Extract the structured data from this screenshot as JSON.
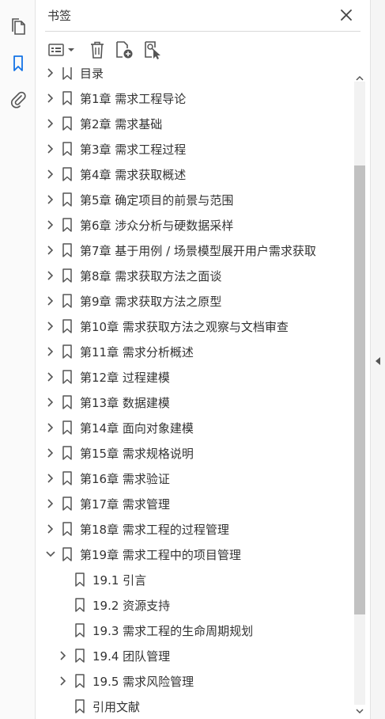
{
  "panel": {
    "title": "书签"
  },
  "rail": {
    "items": [
      {
        "icon": "pages-icon"
      },
      {
        "icon": "bookmark-icon",
        "active": true
      },
      {
        "icon": "attachment-icon"
      }
    ]
  },
  "toolbar": {
    "items": [
      {
        "icon": "options-menu-icon"
      },
      {
        "icon": "delete-icon"
      },
      {
        "icon": "new-bookmark-icon"
      },
      {
        "icon": "bookmark-search-icon"
      }
    ]
  },
  "colors": {
    "accent": "#1473e6",
    "icon": "#555555",
    "scroll_thumb": "#c1c1c1"
  },
  "scroll": {
    "position_fraction": 0.16,
    "visible_fraction": 0.72
  },
  "bookmarks": [
    {
      "label": "目录",
      "level": 0,
      "state": "collapsed"
    },
    {
      "label": "第1章  需求工程导论",
      "level": 0,
      "state": "collapsed"
    },
    {
      "label": "第2章  需求基础",
      "level": 0,
      "state": "collapsed"
    },
    {
      "label": "第3章  需求工程过程",
      "level": 0,
      "state": "collapsed"
    },
    {
      "label": "第4章  需求获取概述",
      "level": 0,
      "state": "collapsed"
    },
    {
      "label": "第5章  确定项目的前景与范围",
      "level": 0,
      "state": "collapsed"
    },
    {
      "label": "第6章  涉众分析与硬数据采样",
      "level": 0,
      "state": "collapsed"
    },
    {
      "label": "第7章  基于用例 / 场景模型展开用户需求获取",
      "level": 0,
      "state": "collapsed"
    },
    {
      "label": "第8章  需求获取方法之面谈",
      "level": 0,
      "state": "collapsed"
    },
    {
      "label": "第9章  需求获取方法之原型",
      "level": 0,
      "state": "collapsed"
    },
    {
      "label": "第10章  需求获取方法之观察与文档审查",
      "level": 0,
      "state": "collapsed"
    },
    {
      "label": "第11章  需求分析概述",
      "level": 0,
      "state": "collapsed"
    },
    {
      "label": "第12章  过程建模",
      "level": 0,
      "state": "collapsed"
    },
    {
      "label": "第13章 数据建模",
      "level": 0,
      "state": "collapsed"
    },
    {
      "label": "第14章 面向对象建模",
      "level": 0,
      "state": "collapsed"
    },
    {
      "label": "第15章  需求规格说明",
      "level": 0,
      "state": "collapsed"
    },
    {
      "label": "第16章  需求验证",
      "level": 0,
      "state": "collapsed"
    },
    {
      "label": "第17章  需求管理",
      "level": 0,
      "state": "collapsed"
    },
    {
      "label": "第18章  需求工程的过程管理",
      "level": 0,
      "state": "collapsed"
    },
    {
      "label": "第19章  需求工程中的项目管理",
      "level": 0,
      "state": "expanded"
    },
    {
      "label": "19.1 引言",
      "level": 1,
      "state": "leaf"
    },
    {
      "label": "19.2 资源支持",
      "level": 1,
      "state": "leaf"
    },
    {
      "label": "19.3 需求工程的生命周期规划",
      "level": 1,
      "state": "leaf"
    },
    {
      "label": "19.4 团队管理",
      "level": 1,
      "state": "collapsed"
    },
    {
      "label": "19.5 需求风险管理",
      "level": 1,
      "state": "collapsed"
    },
    {
      "label": "引用文献",
      "level": 1,
      "state": "leaf"
    }
  ]
}
